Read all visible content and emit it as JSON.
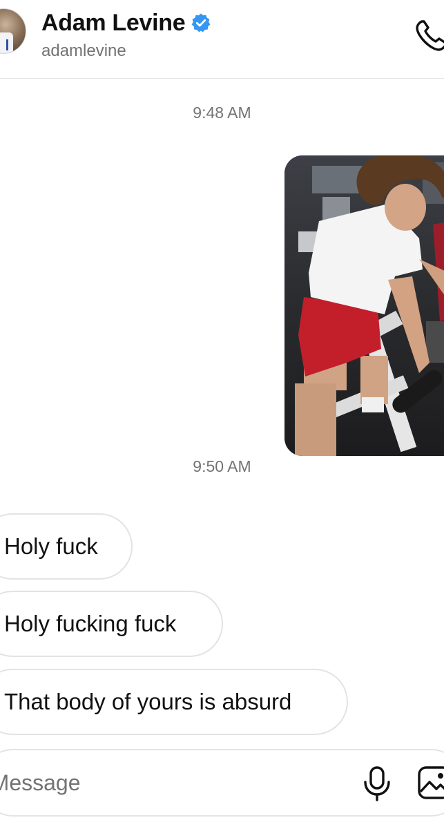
{
  "header": {
    "name": "Adam Levine",
    "handle": "adamlevine",
    "verified": true,
    "icons": [
      "verified-badge-icon",
      "phone-icon"
    ],
    "accent_color": "#3797f0"
  },
  "thread": {
    "timestamps": [
      "9:48 AM",
      "9:50 AM"
    ],
    "photo_message": {
      "sender": "self"
    },
    "received_messages": [
      {
        "text": "Holy fuck"
      },
      {
        "text": "Holy fucking fuck"
      },
      {
        "text": "That body of yours is absurd"
      }
    ]
  },
  "composer": {
    "placeholder": "Message...",
    "icons": [
      "mic-icon",
      "gallery-icon"
    ]
  }
}
